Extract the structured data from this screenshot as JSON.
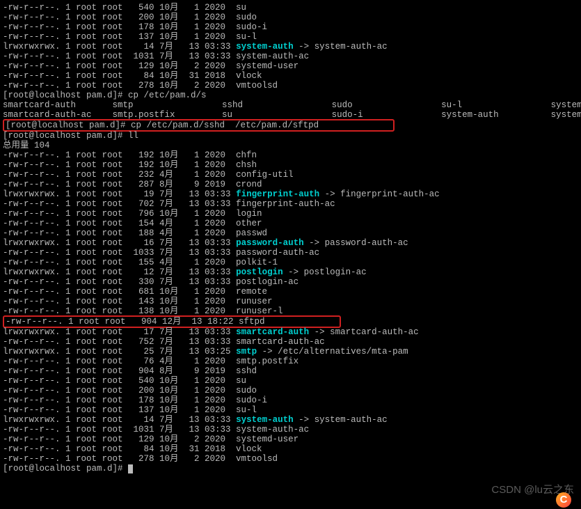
{
  "top_files": [
    {
      "perm": "-rw-r--r--.",
      "links": "1",
      "owner": "root",
      "group": "root",
      "size": "540",
      "month": "10月",
      "day": "1",
      "year": "2020",
      "name": "su",
      "type": "f"
    },
    {
      "perm": "-rw-r--r--.",
      "links": "1",
      "owner": "root",
      "group": "root",
      "size": "200",
      "month": "10月",
      "day": "1",
      "year": "2020",
      "name": "sudo",
      "type": "f"
    },
    {
      "perm": "-rw-r--r--.",
      "links": "1",
      "owner": "root",
      "group": "root",
      "size": "178",
      "month": "10月",
      "day": "1",
      "year": "2020",
      "name": "sudo-i",
      "type": "f"
    },
    {
      "perm": "-rw-r--r--.",
      "links": "1",
      "owner": "root",
      "group": "root",
      "size": "137",
      "month": "10月",
      "day": "1",
      "year": "2020",
      "name": "su-l",
      "type": "f"
    },
    {
      "perm": "lrwxrwxrwx.",
      "links": "1",
      "owner": "root",
      "group": "root",
      "size": "14",
      "month": "7月",
      "day": "13",
      "year": "03:33",
      "name": "system-auth",
      "type": "l",
      "target": "system-auth-ac"
    },
    {
      "perm": "-rw-r--r--.",
      "links": "1",
      "owner": "root",
      "group": "root",
      "size": "1031",
      "month": "7月",
      "day": "13",
      "year": "03:33",
      "name": "system-auth-ac",
      "type": "f"
    },
    {
      "perm": "-rw-r--r--.",
      "links": "1",
      "owner": "root",
      "group": "root",
      "size": "129",
      "month": "10月",
      "day": "2",
      "year": "2020",
      "name": "systemd-user",
      "type": "f"
    },
    {
      "perm": "-rw-r--r--.",
      "links": "1",
      "owner": "root",
      "group": "root",
      "size": "84",
      "month": "10月",
      "day": "31",
      "year": "2018",
      "name": "vlock",
      "type": "f"
    },
    {
      "perm": "-rw-r--r--.",
      "links": "1",
      "owner": "root",
      "group": "root",
      "size": "278",
      "month": "10月",
      "day": "2",
      "year": "2020",
      "name": "vmtoolsd",
      "type": "f"
    }
  ],
  "prompt1": {
    "prefix": "[root@localhost pam.d]# ",
    "cmd": "cp /etc/pam.d/s"
  },
  "tab_row1": {
    "c1": "smartcard-auth",
    "c2": "smtp",
    "c3": "sshd",
    "c4": "sudo",
    "c5": "su-l",
    "c6": "system-auth-ac"
  },
  "tab_row2": {
    "c1": "smartcard-auth-ac",
    "c2": "smtp.postfix",
    "c3": "su",
    "c4": "sudo-i",
    "c5": "system-auth",
    "c6": "systemd-user"
  },
  "prompt2": {
    "prefix": "[root@localhost pam.d]# ",
    "cmd": "cp /etc/pam.d/sshd  /etc/pam.d/sftpd"
  },
  "prompt3": {
    "prefix": "[root@localhost pam.d]# ",
    "cmd": "ll"
  },
  "total": "总用量 104",
  "ll_files": [
    {
      "perm": "-rw-r--r--.",
      "links": "1",
      "own": "root",
      "grp": "root",
      "sz": "192",
      "m": "10月",
      "d": "1",
      "y": "2020",
      "name": "chfn",
      "type": "f"
    },
    {
      "perm": "-rw-r--r--.",
      "links": "1",
      "own": "root",
      "grp": "root",
      "sz": "192",
      "m": "10月",
      "d": "1",
      "y": "2020",
      "name": "chsh",
      "type": "f"
    },
    {
      "perm": "-rw-r--r--.",
      "links": "1",
      "own": "root",
      "grp": "root",
      "sz": "232",
      "m": "4月",
      "d": "1",
      "y": "2020",
      "name": "config-util",
      "type": "f"
    },
    {
      "perm": "-rw-r--r--.",
      "links": "1",
      "own": "root",
      "grp": "root",
      "sz": "287",
      "m": "8月",
      "d": "9",
      "y": "2019",
      "name": "crond",
      "type": "f"
    },
    {
      "perm": "lrwxrwxrwx.",
      "links": "1",
      "own": "root",
      "grp": "root",
      "sz": "19",
      "m": "7月",
      "d": "13",
      "y": "03:33",
      "name": "fingerprint-auth",
      "type": "l",
      "target": "fingerprint-auth-ac"
    },
    {
      "perm": "-rw-r--r--.",
      "links": "1",
      "own": "root",
      "grp": "root",
      "sz": "702",
      "m": "7月",
      "d": "13",
      "y": "03:33",
      "name": "fingerprint-auth-ac",
      "type": "f"
    },
    {
      "perm": "-rw-r--r--.",
      "links": "1",
      "own": "root",
      "grp": "root",
      "sz": "796",
      "m": "10月",
      "d": "1",
      "y": "2020",
      "name": "login",
      "type": "f"
    },
    {
      "perm": "-rw-r--r--.",
      "links": "1",
      "own": "root",
      "grp": "root",
      "sz": "154",
      "m": "4月",
      "d": "1",
      "y": "2020",
      "name": "other",
      "type": "f"
    },
    {
      "perm": "-rw-r--r--.",
      "links": "1",
      "own": "root",
      "grp": "root",
      "sz": "188",
      "m": "4月",
      "d": "1",
      "y": "2020",
      "name": "passwd",
      "type": "f"
    },
    {
      "perm": "lrwxrwxrwx.",
      "links": "1",
      "own": "root",
      "grp": "root",
      "sz": "16",
      "m": "7月",
      "d": "13",
      "y": "03:33",
      "name": "password-auth",
      "type": "l",
      "target": "password-auth-ac"
    },
    {
      "perm": "-rw-r--r--.",
      "links": "1",
      "own": "root",
      "grp": "root",
      "sz": "1033",
      "m": "7月",
      "d": "13",
      "y": "03:33",
      "name": "password-auth-ac",
      "type": "f"
    },
    {
      "perm": "-rw-r--r--.",
      "links": "1",
      "own": "root",
      "grp": "root",
      "sz": "155",
      "m": "4月",
      "d": "1",
      "y": "2020",
      "name": "polkit-1",
      "type": "f"
    },
    {
      "perm": "lrwxrwxrwx.",
      "links": "1",
      "own": "root",
      "grp": "root",
      "sz": "12",
      "m": "7月",
      "d": "13",
      "y": "03:33",
      "name": "postlogin",
      "type": "l",
      "target": "postlogin-ac"
    },
    {
      "perm": "-rw-r--r--.",
      "links": "1",
      "own": "root",
      "grp": "root",
      "sz": "330",
      "m": "7月",
      "d": "13",
      "y": "03:33",
      "name": "postlogin-ac",
      "type": "f"
    },
    {
      "perm": "-rw-r--r--.",
      "links": "1",
      "own": "root",
      "grp": "root",
      "sz": "681",
      "m": "10月",
      "d": "1",
      "y": "2020",
      "name": "remote",
      "type": "f"
    },
    {
      "perm": "-rw-r--r--.",
      "links": "1",
      "own": "root",
      "grp": "root",
      "sz": "143",
      "m": "10月",
      "d": "1",
      "y": "2020",
      "name": "runuser",
      "type": "f"
    },
    {
      "perm": "-rw-r--r--.",
      "links": "1",
      "own": "root",
      "grp": "root",
      "sz": "138",
      "m": "10月",
      "d": "1",
      "y": "2020",
      "name": "runuser-l",
      "type": "f"
    },
    {
      "perm": "-rw-r--r--.",
      "links": "1",
      "own": "root",
      "grp": "root",
      "sz": "904",
      "m": "12月",
      "d": "13",
      "y": "18:22",
      "name": "sftpd",
      "type": "f",
      "hl": true
    },
    {
      "perm": "lrwxrwxrwx.",
      "links": "1",
      "own": "root",
      "grp": "root",
      "sz": "17",
      "m": "7月",
      "d": "13",
      "y": "03:33",
      "name": "smartcard-auth",
      "type": "l",
      "target": "smartcard-auth-ac"
    },
    {
      "perm": "-rw-r--r--.",
      "links": "1",
      "own": "root",
      "grp": "root",
      "sz": "752",
      "m": "7月",
      "d": "13",
      "y": "03:33",
      "name": "smartcard-auth-ac",
      "type": "f"
    },
    {
      "perm": "lrwxrwxrwx.",
      "links": "1",
      "own": "root",
      "grp": "root",
      "sz": "25",
      "m": "7月",
      "d": "13",
      "y": "03:25",
      "name": "smtp",
      "type": "l",
      "target": "/etc/alternatives/mta-pam"
    },
    {
      "perm": "-rw-r--r--.",
      "links": "1",
      "own": "root",
      "grp": "root",
      "sz": "76",
      "m": "4月",
      "d": "1",
      "y": "2020",
      "name": "smtp.postfix",
      "type": "f"
    },
    {
      "perm": "-rw-r--r--.",
      "links": "1",
      "own": "root",
      "grp": "root",
      "sz": "904",
      "m": "8月",
      "d": "9",
      "y": "2019",
      "name": "sshd",
      "type": "f"
    },
    {
      "perm": "-rw-r--r--.",
      "links": "1",
      "own": "root",
      "grp": "root",
      "sz": "540",
      "m": "10月",
      "d": "1",
      "y": "2020",
      "name": "su",
      "type": "f"
    },
    {
      "perm": "-rw-r--r--.",
      "links": "1",
      "own": "root",
      "grp": "root",
      "sz": "200",
      "m": "10月",
      "d": "1",
      "y": "2020",
      "name": "sudo",
      "type": "f"
    },
    {
      "perm": "-rw-r--r--.",
      "links": "1",
      "own": "root",
      "grp": "root",
      "sz": "178",
      "m": "10月",
      "d": "1",
      "y": "2020",
      "name": "sudo-i",
      "type": "f"
    },
    {
      "perm": "-rw-r--r--.",
      "links": "1",
      "own": "root",
      "grp": "root",
      "sz": "137",
      "m": "10月",
      "d": "1",
      "y": "2020",
      "name": "su-l",
      "type": "f"
    },
    {
      "perm": "lrwxrwxrwx.",
      "links": "1",
      "own": "root",
      "grp": "root",
      "sz": "14",
      "m": "7月",
      "d": "13",
      "y": "03:33",
      "name": "system-auth",
      "type": "l",
      "target": "system-auth-ac"
    },
    {
      "perm": "-rw-r--r--.",
      "links": "1",
      "own": "root",
      "grp": "root",
      "sz": "1031",
      "m": "7月",
      "d": "13",
      "y": "03:33",
      "name": "system-auth-ac",
      "type": "f"
    },
    {
      "perm": "-rw-r--r--.",
      "links": "1",
      "own": "root",
      "grp": "root",
      "sz": "129",
      "m": "10月",
      "d": "2",
      "y": "2020",
      "name": "systemd-user",
      "type": "f"
    },
    {
      "perm": "-rw-r--r--.",
      "links": "1",
      "own": "root",
      "grp": "root",
      "sz": "84",
      "m": "10月",
      "d": "31",
      "y": "2018",
      "name": "vlock",
      "type": "f"
    },
    {
      "perm": "-rw-r--r--.",
      "links": "1",
      "own": "root",
      "grp": "root",
      "sz": "278",
      "m": "10月",
      "d": "2",
      "y": "2020",
      "name": "vmtoolsd",
      "type": "f"
    }
  ],
  "prompt_end": {
    "prefix": "[root@localhost pam.d]# "
  },
  "watermark": "CSDN @lu云之东"
}
